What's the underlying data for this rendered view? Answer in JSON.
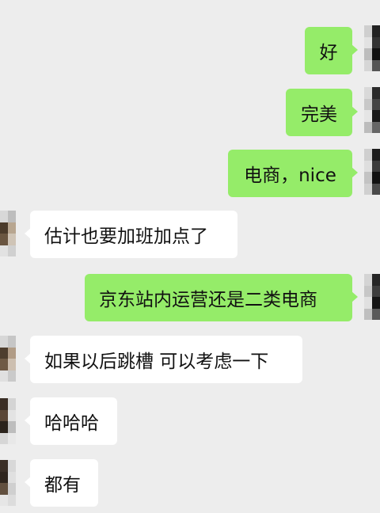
{
  "messages": [
    {
      "side": "out",
      "text": "好"
    },
    {
      "side": "out",
      "text": "完美"
    },
    {
      "side": "out",
      "text": "电商，nice"
    },
    {
      "side": "in",
      "text": "估计也要加班加点了"
    },
    {
      "side": "out",
      "text": "京东站内运营还是二类电商"
    },
    {
      "side": "in",
      "text": "如果以后跳槽 可以考虑一下"
    },
    {
      "side": "in",
      "text": "哈哈哈"
    },
    {
      "side": "in",
      "text": "都有"
    }
  ]
}
